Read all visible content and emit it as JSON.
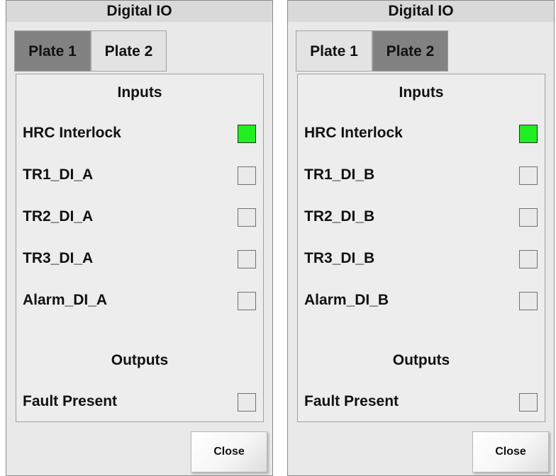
{
  "dialogs": [
    {
      "title": "Digital IO",
      "tabs": [
        {
          "label": "Plate 1",
          "active": true
        },
        {
          "label": "Plate 2",
          "active": false
        }
      ],
      "inputs_title": "Inputs",
      "inputs": [
        {
          "label": "HRC Interlock",
          "state": "on",
          "color": "#22ee22"
        },
        {
          "label": "TR1_DI_A",
          "state": "off"
        },
        {
          "label": "TR2_DI_A",
          "state": "off"
        },
        {
          "label": "TR3_DI_A",
          "state": "off"
        },
        {
          "label": "Alarm_DI_A",
          "state": "off"
        }
      ],
      "outputs_title": "Outputs",
      "outputs": [
        {
          "label": "Fault Present",
          "state": "off"
        }
      ],
      "close_label": "Close"
    },
    {
      "title": "Digital IO",
      "tabs": [
        {
          "label": "Plate 1",
          "active": false
        },
        {
          "label": "Plate 2",
          "active": true
        }
      ],
      "inputs_title": "Inputs",
      "inputs": [
        {
          "label": "HRC Interlock",
          "state": "on",
          "color": "#22ee22"
        },
        {
          "label": "TR1_DI_B",
          "state": "off"
        },
        {
          "label": "TR2_DI_B",
          "state": "off"
        },
        {
          "label": "TR3_DI_B",
          "state": "off"
        },
        {
          "label": "Alarm_DI_B",
          "state": "off"
        }
      ],
      "outputs_title": "Outputs",
      "outputs": [
        {
          "label": "Fault Present",
          "state": "off"
        }
      ],
      "close_label": "Close"
    }
  ]
}
